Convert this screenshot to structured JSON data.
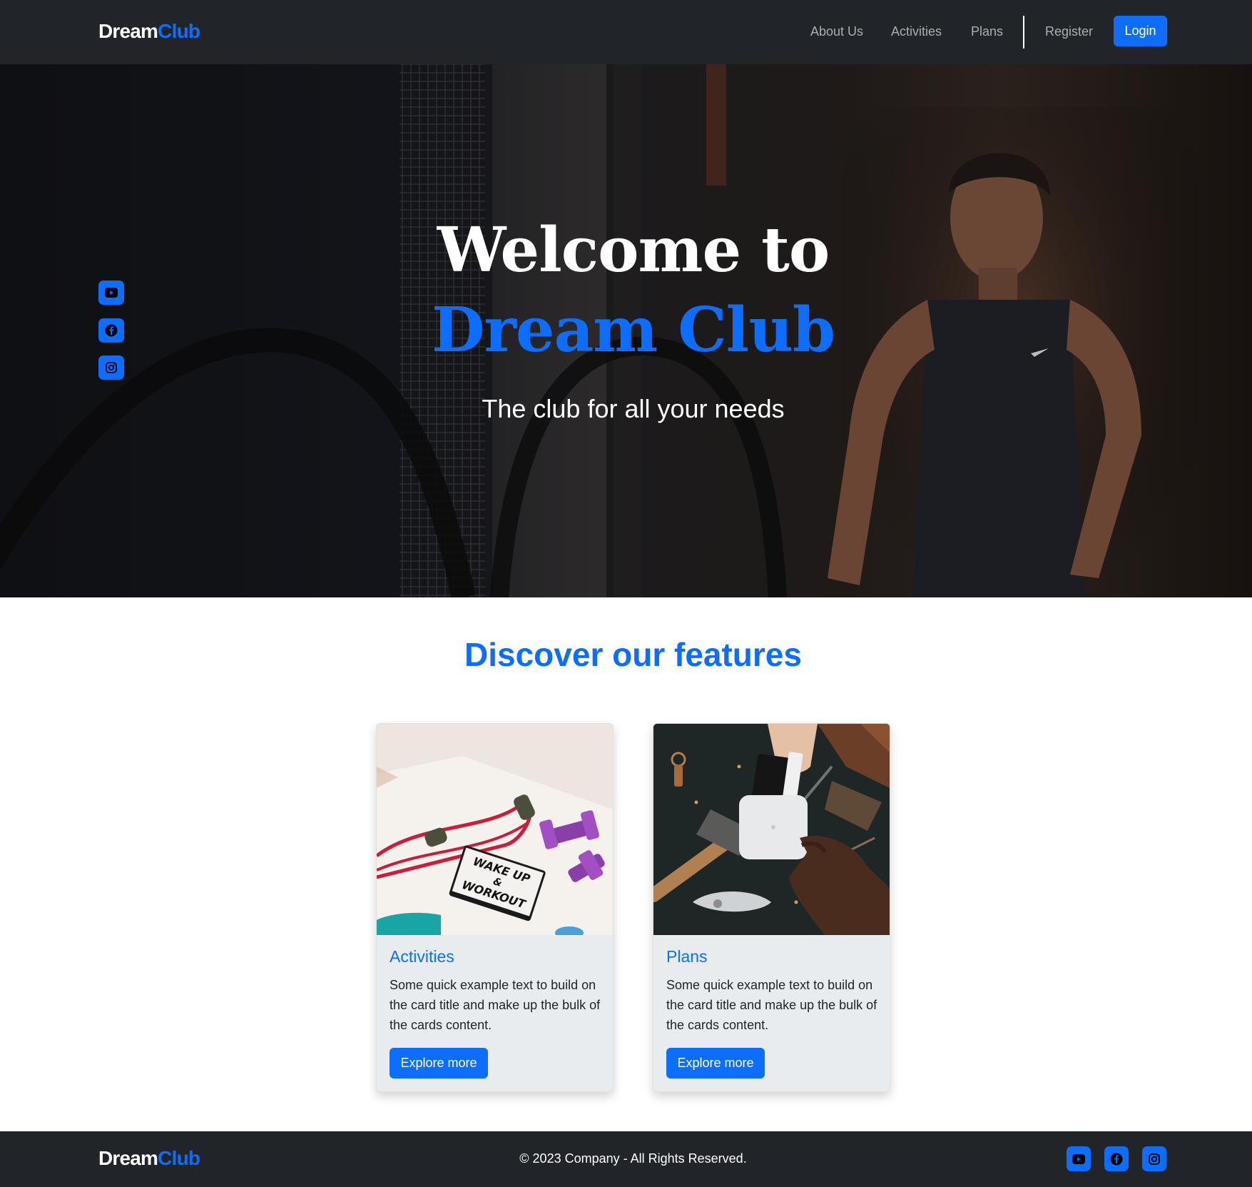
{
  "brand": {
    "part1": "Dream",
    "part2": "Club"
  },
  "nav": {
    "about": "About Us",
    "activities": "Activities",
    "plans": "Plans",
    "register": "Register",
    "login": "Login"
  },
  "hero": {
    "line1": "Welcome to",
    "line2": "Dream Club",
    "subtitle": "The club for all your needs"
  },
  "social": {
    "icons": [
      "youtube-icon",
      "facebook-icon",
      "instagram-icon"
    ]
  },
  "features": {
    "title": "Discover our features",
    "cards": [
      {
        "title": "Activities",
        "text": "Some quick example text to build on the card title and make up the bulk of the cards content.",
        "button": "Explore more",
        "image_lettering": "WAKE UP & WORKOUT"
      },
      {
        "title": "Plans",
        "text": "Some quick example text to build on the card title and make up the bulk of the cards content.",
        "button": "Explore more"
      }
    ]
  },
  "footer": {
    "copyright": "© 2023 Company - All Rights Reserved."
  },
  "colors": {
    "primary": "#0d6efd",
    "dark": "#212529",
    "white": "#ffffff",
    "card_bg": "#e9ecef"
  }
}
